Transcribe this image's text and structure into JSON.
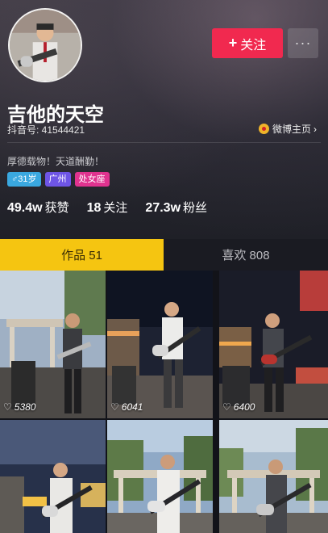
{
  "header": {
    "follow_label": "关注",
    "follow_icon": "plus-icon",
    "more_icon": "more-dots-icon",
    "nickname": "吉他的天空",
    "douyin_id": "抖音号: 41544421",
    "weibo_label": "微博主页",
    "bio": "厚德载物！天道酬勤！",
    "tags": {
      "gender": "♂31岁",
      "city": "广州",
      "zodiac": "处女座"
    },
    "stats": {
      "likes_value": "49.4w",
      "likes_label": "获赞",
      "following_value": "18",
      "following_label": "关注",
      "fans_value": "27.3w",
      "fans_label": "粉丝"
    }
  },
  "tabs": {
    "works": "作品 51",
    "likes": "喜欢 808"
  },
  "colors": {
    "follow_button": "#f1294f",
    "active_tab": "#f5c511",
    "tag_gender": "#3aa8e0",
    "tag_city": "#6e55e6",
    "tag_zodiac": "#e0338f"
  },
  "videos": [
    {
      "likes": "5380"
    },
    {
      "likes": "6041"
    },
    {
      "likes": "6400"
    },
    {
      "likes": ""
    },
    {
      "likes": ""
    },
    {
      "likes": ""
    }
  ]
}
